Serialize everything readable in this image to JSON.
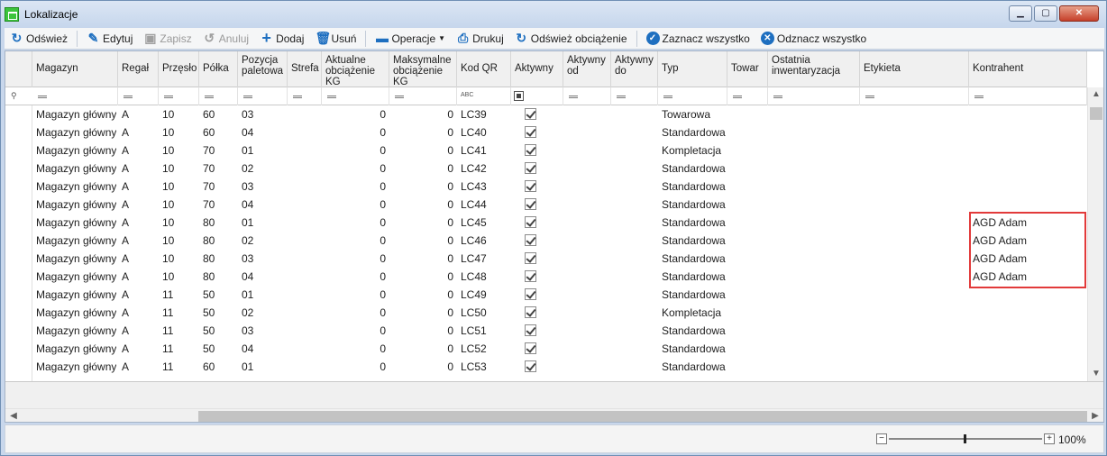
{
  "window": {
    "title": "Lokalizacje"
  },
  "toolbar": {
    "refresh": "Odśwież",
    "edit": "Edytuj",
    "save": "Zapisz",
    "cancel": "Anuluj",
    "add": "Dodaj",
    "delete": "Usuń",
    "operations": "Operacje",
    "print": "Drukuj",
    "refresh_load": "Odśwież obciążenie",
    "select_all": "Zaznacz wszystko",
    "deselect_all": "Odznacz wszystko"
  },
  "columns": [
    {
      "key": "magazyn",
      "label": "Magazyn"
    },
    {
      "key": "regal",
      "label": "Regał"
    },
    {
      "key": "przeslo",
      "label": "Przęsło"
    },
    {
      "key": "polka",
      "label": "Półka"
    },
    {
      "key": "pozycja",
      "label": "Pozycja paletowa"
    },
    {
      "key": "strefa",
      "label": "Strefa"
    },
    {
      "key": "akt_obc",
      "label": "Aktualne obciążenie KG"
    },
    {
      "key": "max_obc",
      "label": "Maksymalne obciążenie KG"
    },
    {
      "key": "kod_qr",
      "label": "Kod QR"
    },
    {
      "key": "aktywny",
      "label": "Aktywny"
    },
    {
      "key": "aktywny_od",
      "label": "Aktywny od"
    },
    {
      "key": "aktywny_do",
      "label": "Aktywny do"
    },
    {
      "key": "typ",
      "label": "Typ"
    },
    {
      "key": "towar",
      "label": "Towar"
    },
    {
      "key": "ostatnia_inw",
      "label": "Ostatnia inwentaryzacja"
    },
    {
      "key": "etykieta",
      "label": "Etykieta"
    },
    {
      "key": "kontrahent",
      "label": "Kontrahent"
    }
  ],
  "rows": [
    {
      "magazyn": "Magazyn główny",
      "regal": "A",
      "przeslo": "10",
      "polka": "60",
      "pozycja": "03",
      "akt_obc": "0",
      "max_obc": "0",
      "kod_qr": "LC39",
      "aktywny": true,
      "typ": "Towarowa",
      "kontrahent": ""
    },
    {
      "magazyn": "Magazyn główny",
      "regal": "A",
      "przeslo": "10",
      "polka": "60",
      "pozycja": "04",
      "akt_obc": "0",
      "max_obc": "0",
      "kod_qr": "LC40",
      "aktywny": true,
      "typ": "Standardowa",
      "kontrahent": ""
    },
    {
      "magazyn": "Magazyn główny",
      "regal": "A",
      "przeslo": "10",
      "polka": "70",
      "pozycja": "01",
      "akt_obc": "0",
      "max_obc": "0",
      "kod_qr": "LC41",
      "aktywny": true,
      "typ": "Kompletacja",
      "kontrahent": ""
    },
    {
      "magazyn": "Magazyn główny",
      "regal": "A",
      "przeslo": "10",
      "polka": "70",
      "pozycja": "02",
      "akt_obc": "0",
      "max_obc": "0",
      "kod_qr": "LC42",
      "aktywny": true,
      "typ": "Standardowa",
      "kontrahent": ""
    },
    {
      "magazyn": "Magazyn główny",
      "regal": "A",
      "przeslo": "10",
      "polka": "70",
      "pozycja": "03",
      "akt_obc": "0",
      "max_obc": "0",
      "kod_qr": "LC43",
      "aktywny": true,
      "typ": "Standardowa",
      "kontrahent": ""
    },
    {
      "magazyn": "Magazyn główny",
      "regal": "A",
      "przeslo": "10",
      "polka": "70",
      "pozycja": "04",
      "akt_obc": "0",
      "max_obc": "0",
      "kod_qr": "LC44",
      "aktywny": true,
      "typ": "Standardowa",
      "kontrahent": ""
    },
    {
      "magazyn": "Magazyn główny",
      "regal": "A",
      "przeslo": "10",
      "polka": "80",
      "pozycja": "01",
      "akt_obc": "0",
      "max_obc": "0",
      "kod_qr": "LC45",
      "aktywny": true,
      "typ": "Standardowa",
      "kontrahent": "AGD Adam"
    },
    {
      "magazyn": "Magazyn główny",
      "regal": "A",
      "przeslo": "10",
      "polka": "80",
      "pozycja": "02",
      "akt_obc": "0",
      "max_obc": "0",
      "kod_qr": "LC46",
      "aktywny": true,
      "typ": "Standardowa",
      "kontrahent": "AGD Adam"
    },
    {
      "magazyn": "Magazyn główny",
      "regal": "A",
      "przeslo": "10",
      "polka": "80",
      "pozycja": "03",
      "akt_obc": "0",
      "max_obc": "0",
      "kod_qr": "LC47",
      "aktywny": true,
      "typ": "Standardowa",
      "kontrahent": "AGD Adam"
    },
    {
      "magazyn": "Magazyn główny",
      "regal": "A",
      "przeslo": "10",
      "polka": "80",
      "pozycja": "04",
      "akt_obc": "0",
      "max_obc": "0",
      "kod_qr": "LC48",
      "aktywny": true,
      "typ": "Standardowa",
      "kontrahent": "AGD Adam"
    },
    {
      "magazyn": "Magazyn główny",
      "regal": "A",
      "przeslo": "11",
      "polka": "50",
      "pozycja": "01",
      "akt_obc": "0",
      "max_obc": "0",
      "kod_qr": "LC49",
      "aktywny": true,
      "typ": "Standardowa",
      "kontrahent": ""
    },
    {
      "magazyn": "Magazyn główny",
      "regal": "A",
      "przeslo": "11",
      "polka": "50",
      "pozycja": "02",
      "akt_obc": "0",
      "max_obc": "0",
      "kod_qr": "LC50",
      "aktywny": true,
      "typ": "Kompletacja",
      "kontrahent": ""
    },
    {
      "magazyn": "Magazyn główny",
      "regal": "A",
      "przeslo": "11",
      "polka": "50",
      "pozycja": "03",
      "akt_obc": "0",
      "max_obc": "0",
      "kod_qr": "LC51",
      "aktywny": true,
      "typ": "Standardowa",
      "kontrahent": ""
    },
    {
      "magazyn": "Magazyn główny",
      "regal": "A",
      "przeslo": "11",
      "polka": "50",
      "pozycja": "04",
      "akt_obc": "0",
      "max_obc": "0",
      "kod_qr": "LC52",
      "aktywny": true,
      "typ": "Standardowa",
      "kontrahent": ""
    },
    {
      "magazyn": "Magazyn główny",
      "regal": "A",
      "przeslo": "11",
      "polka": "60",
      "pozycja": "01",
      "akt_obc": "0",
      "max_obc": "0",
      "kod_qr": "LC53",
      "aktywny": true,
      "typ": "Standardowa",
      "kontrahent": ""
    }
  ],
  "statusbar": {
    "zoom_label": "100%",
    "zoom_minus": "−",
    "zoom_plus": "+"
  },
  "icons": {
    "refresh": "refresh-icon",
    "edit": "edit-icon",
    "save": "save-icon",
    "cancel": "undo-icon",
    "add": "plus-icon",
    "delete": "trash-icon",
    "operations": "folder-icon",
    "print": "printer-icon",
    "select_all": "check-circle-icon",
    "deselect_all": "x-circle-icon"
  },
  "colors": {
    "accent": "#1e6fc0",
    "highlight_border": "#e23a3a"
  }
}
